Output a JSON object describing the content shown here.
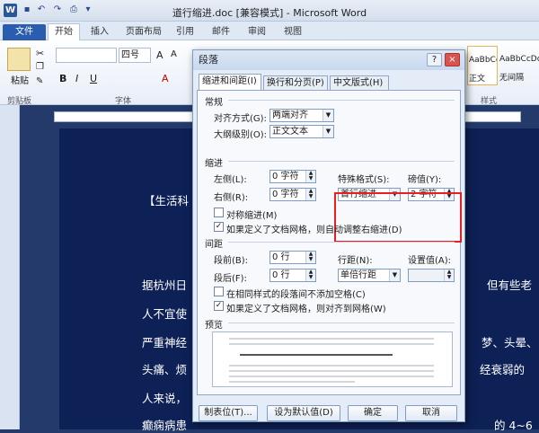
{
  "window": {
    "title": "道行缩进.doc [兼容模式] - Microsoft Word",
    "app_icon": "W"
  },
  "quick_access": [
    "save-icon",
    "undo-icon",
    "redo-icon",
    "print-icon",
    "customize-icon"
  ],
  "ribbon_tabs": [
    "文件",
    "开始",
    "插入",
    "页面布局",
    "引用",
    "邮件",
    "审阅",
    "视图"
  ],
  "ribbon": {
    "clipboard_group": "剪贴板",
    "paste": "粘贴",
    "font_group": "字体",
    "font_size": "四号",
    "styles_group": "样式",
    "style_normal": "正文",
    "style_nospacing": "无间隔",
    "style_sample": "AaBbCcDc",
    "style_sample2": "AaBbCcDc"
  },
  "document": {
    "lines": [
      "【生活科",
      "据杭州日",
      "但有些老",
      "人不宜使",
      "严重神经",
      "梦、头晕、",
      "头痛、烦",
      "经衰弱的",
      "人来说，",
      "癫痫病患",
      "的 4~6"
    ]
  },
  "dialog": {
    "title": "段落",
    "help": "?",
    "close": "×",
    "tabs": [
      "缩进和间距(I)",
      "换行和分页(P)",
      "中文版式(H)"
    ],
    "general": {
      "heading": "常规",
      "align_label": "对齐方式(G):",
      "align_value": "两端对齐",
      "outline_label": "大纲级别(O):",
      "outline_value": "正文文本"
    },
    "indent": {
      "heading": "缩进",
      "left_label": "左侧(L):",
      "left_value": "0 字符",
      "right_label": "右侧(R):",
      "right_value": "0 字符",
      "special_label": "特殊格式(S):",
      "special_value": "首行缩进",
      "by_label": "磅值(Y):",
      "by_value": "2 字符",
      "mirror_label": "对称缩进(M)",
      "auto_label": "如果定义了文档网格，则自动调整右缩进(D)",
      "auto_checked": true,
      "mirror_checked": false
    },
    "spacing": {
      "heading": "间距",
      "before_label": "段前(B):",
      "before_value": "0 行",
      "after_label": "段后(F):",
      "after_value": "0 行",
      "line_label": "行距(N):",
      "line_value": "单倍行距",
      "at_label": "设置值(A):",
      "at_value": "",
      "nospace_label": "在相同样式的段落间不添加空格(C)",
      "snap_label": "如果定义了文档网格，则对齐到网格(W)",
      "nospace_checked": false,
      "snap_checked": true
    },
    "preview": {
      "heading": "预览"
    },
    "buttons": {
      "tabs": "制表位(T)...",
      "default": "设为默认值(D)",
      "ok": "确定",
      "cancel": "取消"
    }
  },
  "colors": {
    "highlight": "#e62020",
    "page": "#0e2156"
  }
}
